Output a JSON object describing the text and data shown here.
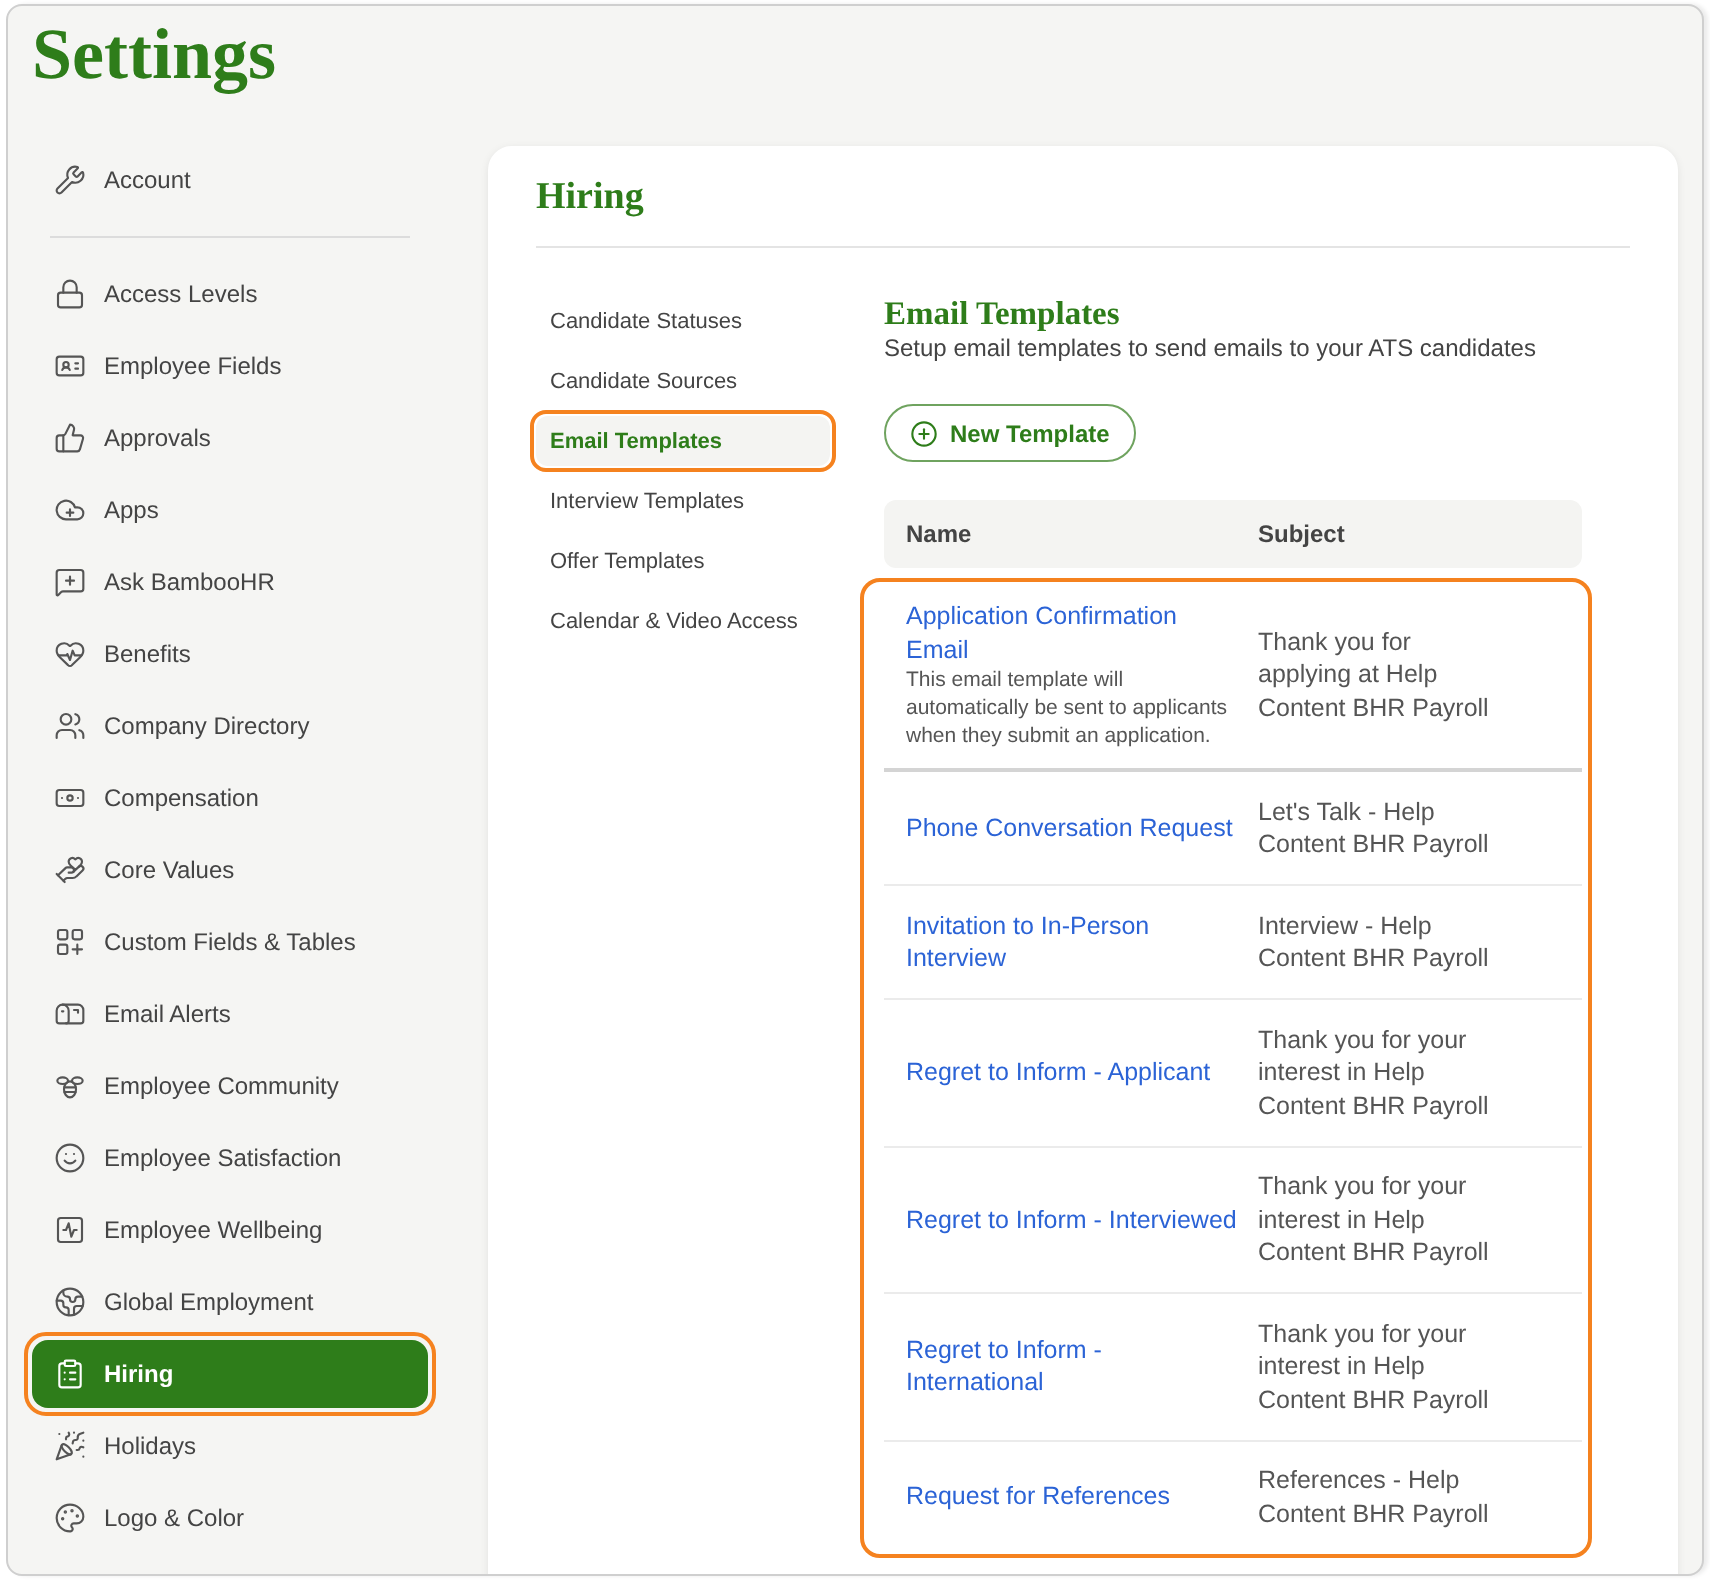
{
  "page": {
    "title": "Settings"
  },
  "sidebar": {
    "groups": [
      {
        "items": [
          {
            "label": "Account",
            "selected": false,
            "highlighted": false
          }
        ]
      },
      {
        "items": [
          {
            "label": "Access Levels",
            "selected": false,
            "highlighted": false
          },
          {
            "label": "Employee Fields",
            "selected": false,
            "highlighted": false
          },
          {
            "label": "Approvals",
            "selected": false,
            "highlighted": false
          },
          {
            "label": "Apps",
            "selected": false,
            "highlighted": false
          },
          {
            "label": "Ask BambooHR",
            "selected": false,
            "highlighted": false
          },
          {
            "label": "Benefits",
            "selected": false,
            "highlighted": false
          },
          {
            "label": "Company Directory",
            "selected": false,
            "highlighted": false
          },
          {
            "label": "Compensation",
            "selected": false,
            "highlighted": false
          },
          {
            "label": "Core Values",
            "selected": false,
            "highlighted": false
          },
          {
            "label": "Custom Fields & Tables",
            "selected": false,
            "highlighted": false
          },
          {
            "label": "Email Alerts",
            "selected": false,
            "highlighted": false
          },
          {
            "label": "Employee Community",
            "selected": false,
            "highlighted": false
          },
          {
            "label": "Employee Satisfaction",
            "selected": false,
            "highlighted": false
          },
          {
            "label": "Employee Wellbeing",
            "selected": false,
            "highlighted": false
          },
          {
            "label": "Global Employment",
            "selected": false,
            "highlighted": false
          },
          {
            "label": "Hiring",
            "selected": true,
            "highlighted": true
          },
          {
            "label": "Holidays",
            "selected": false,
            "highlighted": false
          },
          {
            "label": "Logo & Color",
            "selected": false,
            "highlighted": false
          }
        ]
      }
    ]
  },
  "card": {
    "title": "Hiring",
    "subnav": [
      {
        "label": "Candidate Statuses",
        "selected": false,
        "highlighted": false
      },
      {
        "label": "Candidate Sources",
        "selected": false,
        "highlighted": false
      },
      {
        "label": "Email Templates",
        "selected": true,
        "highlighted": true
      },
      {
        "label": "Interview Templates",
        "selected": false,
        "highlighted": false
      },
      {
        "label": "Offer Templates",
        "selected": false,
        "highlighted": false
      },
      {
        "label": "Calendar & Video Access",
        "selected": false,
        "highlighted": false
      }
    ],
    "content": {
      "title": "Email Templates",
      "subtitle": "Setup email templates to send emails to your ATS candidates",
      "new_button": "New Template",
      "table": {
        "columns": [
          "Name",
          "Subject"
        ],
        "rows_highlighted": true,
        "rows": [
          {
            "name": "Application Confirmation Email",
            "description": "This email template will automatically be sent to applicants when they submit an application.",
            "subject": "Thank you for applying at Help Content BHR Payroll"
          },
          {
            "name": "Phone Conversation Request",
            "subject": "Let's Talk - Help Content BHR Payroll"
          },
          {
            "name": "Invitation to In-Person Interview",
            "subject": "Interview - Help Content BHR Payroll"
          },
          {
            "name": "Regret to Inform - Applicant",
            "subject": "Thank you for your interest in Help Content BHR Payroll"
          },
          {
            "name": "Regret to Inform - Interviewed",
            "subject": "Thank you for your interest in Help Content BHR Payroll"
          },
          {
            "name": "Regret to Inform - International",
            "subject": "Thank you for your interest in Help Content BHR Payroll"
          },
          {
            "name": "Request for References",
            "subject": "References - Help Content BHR Payroll"
          }
        ]
      }
    }
  }
}
